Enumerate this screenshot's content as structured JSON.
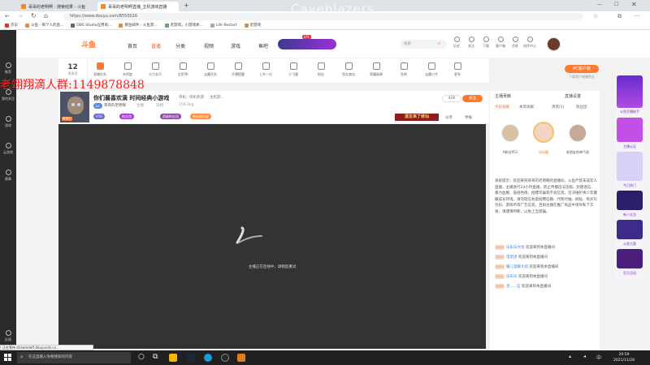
{
  "browser": {
    "tabs": [
      {
        "label": "哥哥的老明啊 - 搜索结果 - 斗鱼"
      },
      {
        "label": "哥哥的老明啊直播_主机游戏直播"
      }
    ],
    "url": "https://www.douyu.com/8550016",
    "bookmarks": [
      "京东",
      "斗鱼 - 每个人的直...",
      "OBS Studio应用商...",
      "摸鱼邮件 - 斗鱼游...",
      "老游戏，小游戏休...",
      "Life Restart",
      "老游戏"
    ]
  },
  "watermark": "Caveblazers",
  "overlay_text": "老翊翔滴人群:1149878848",
  "sidebar": {
    "items": [
      "推荐",
      "我的关注",
      "游戏",
      "云游戏",
      "赛事",
      "反馈"
    ]
  },
  "header": {
    "logo": "斗鱼",
    "nav": [
      "首页",
      "直播",
      "分类",
      "视频",
      "游戏",
      "鱼吧"
    ],
    "search_placeholder": "搜索",
    "icons": [
      "历史",
      "关注",
      "下载",
      "客户端",
      "消息",
      "创作中心"
    ],
    "event_badge": "LPL"
  },
  "toolbar": {
    "rank_number": "12",
    "rank_label": "周星榜",
    "items": [
      "直播任务",
      "亲密度",
      "大力金币",
      "全民PK",
      "宝藏任务",
      "开播提醒",
      "上升一位",
      "小飞鹿",
      "粉丝",
      "鱼丸商店",
      "荣耀勋章",
      "鱼吧",
      "宝藏口令",
      "更多"
    ],
    "pc_button": "PC客户端",
    "pc_sub": "下载客户端赚鱼丸"
  },
  "room": {
    "title": "你们最喜欢滴 时间经典小游戏",
    "category": "单机",
    "tags": [
      "单机热游",
      "主机游..."
    ],
    "anchor": "哥哥的老明啊",
    "stats": [
      "主播",
      "日榜",
      "159.2kg"
    ],
    "badges": [
      "V19",
      "粉丝团",
      "超级粉丝团",
      "粉丝俱乐部"
    ],
    "avatar_badge": "直播中",
    "follow_count": "42K",
    "follow_label": "关注",
    "ad_text": "道友来了修仙",
    "share": "分享",
    "report": "举报"
  },
  "video": {
    "loading_text": "主播正在连线中，请稍后重试"
  },
  "chat": {
    "title": "主播贡献",
    "settings": "直播设置",
    "tabs": [
      "今日贡献",
      "本周贡献",
      "贵宾(5)",
      "粉丝团"
    ],
    "top_users": [
      {
        "name": "A粉丝952"
      },
      {
        "name": "电动圆"
      },
      {
        "name": "老朋友的神气鼠"
      }
    ],
    "system_notice": "系统提示：欢迎来到哥哥的老明啊的直播间，斗鱼严禁未成年人直播，主播进行24小时直播，禁止传播违法违规、封建迷信、暴力血腥、低俗色情、招嫖诈骗等不良信息。坚决维护青少年健康成长环境。请勿轻信各类招聘征婚、代练代抽、刷钻、购买礼包码、游戏币等广告信息，且如主播在推广商品中诱导私下交易，请谨慎判断，以免上当受骗。",
    "messages": [
      {
        "level": "LV10",
        "user": "乐乐乐大地",
        "text": "欢迎来到本直播间"
      },
      {
        "level": "LV17",
        "user": "电老虎",
        "text": "欢迎来到本直播间"
      },
      {
        "level": "LV13",
        "user": "暖儿温暖大叔",
        "text": "欢迎来到本直播间"
      },
      {
        "level": "LV10",
        "user": "乐乐乐",
        "text": "欢迎来到本直播间"
      },
      {
        "level": "LV10",
        "user": "灵......石",
        "text": "欢迎来到本直播间"
      }
    ]
  },
  "promo": {
    "header": "斗鱼开播助手",
    "items": [
      "主播认证",
      "今日热门",
      "新人礼包",
      "斗鱼大赛",
      "官方活动",
      "运营推荐"
    ]
  },
  "statusbar": "正在等待 streamdeft.douyucdn.cn...",
  "taskbar": {
    "search_placeholder": "在这里输入你要搜索的内容",
    "time": "20:59",
    "date": "2021/11/28"
  }
}
